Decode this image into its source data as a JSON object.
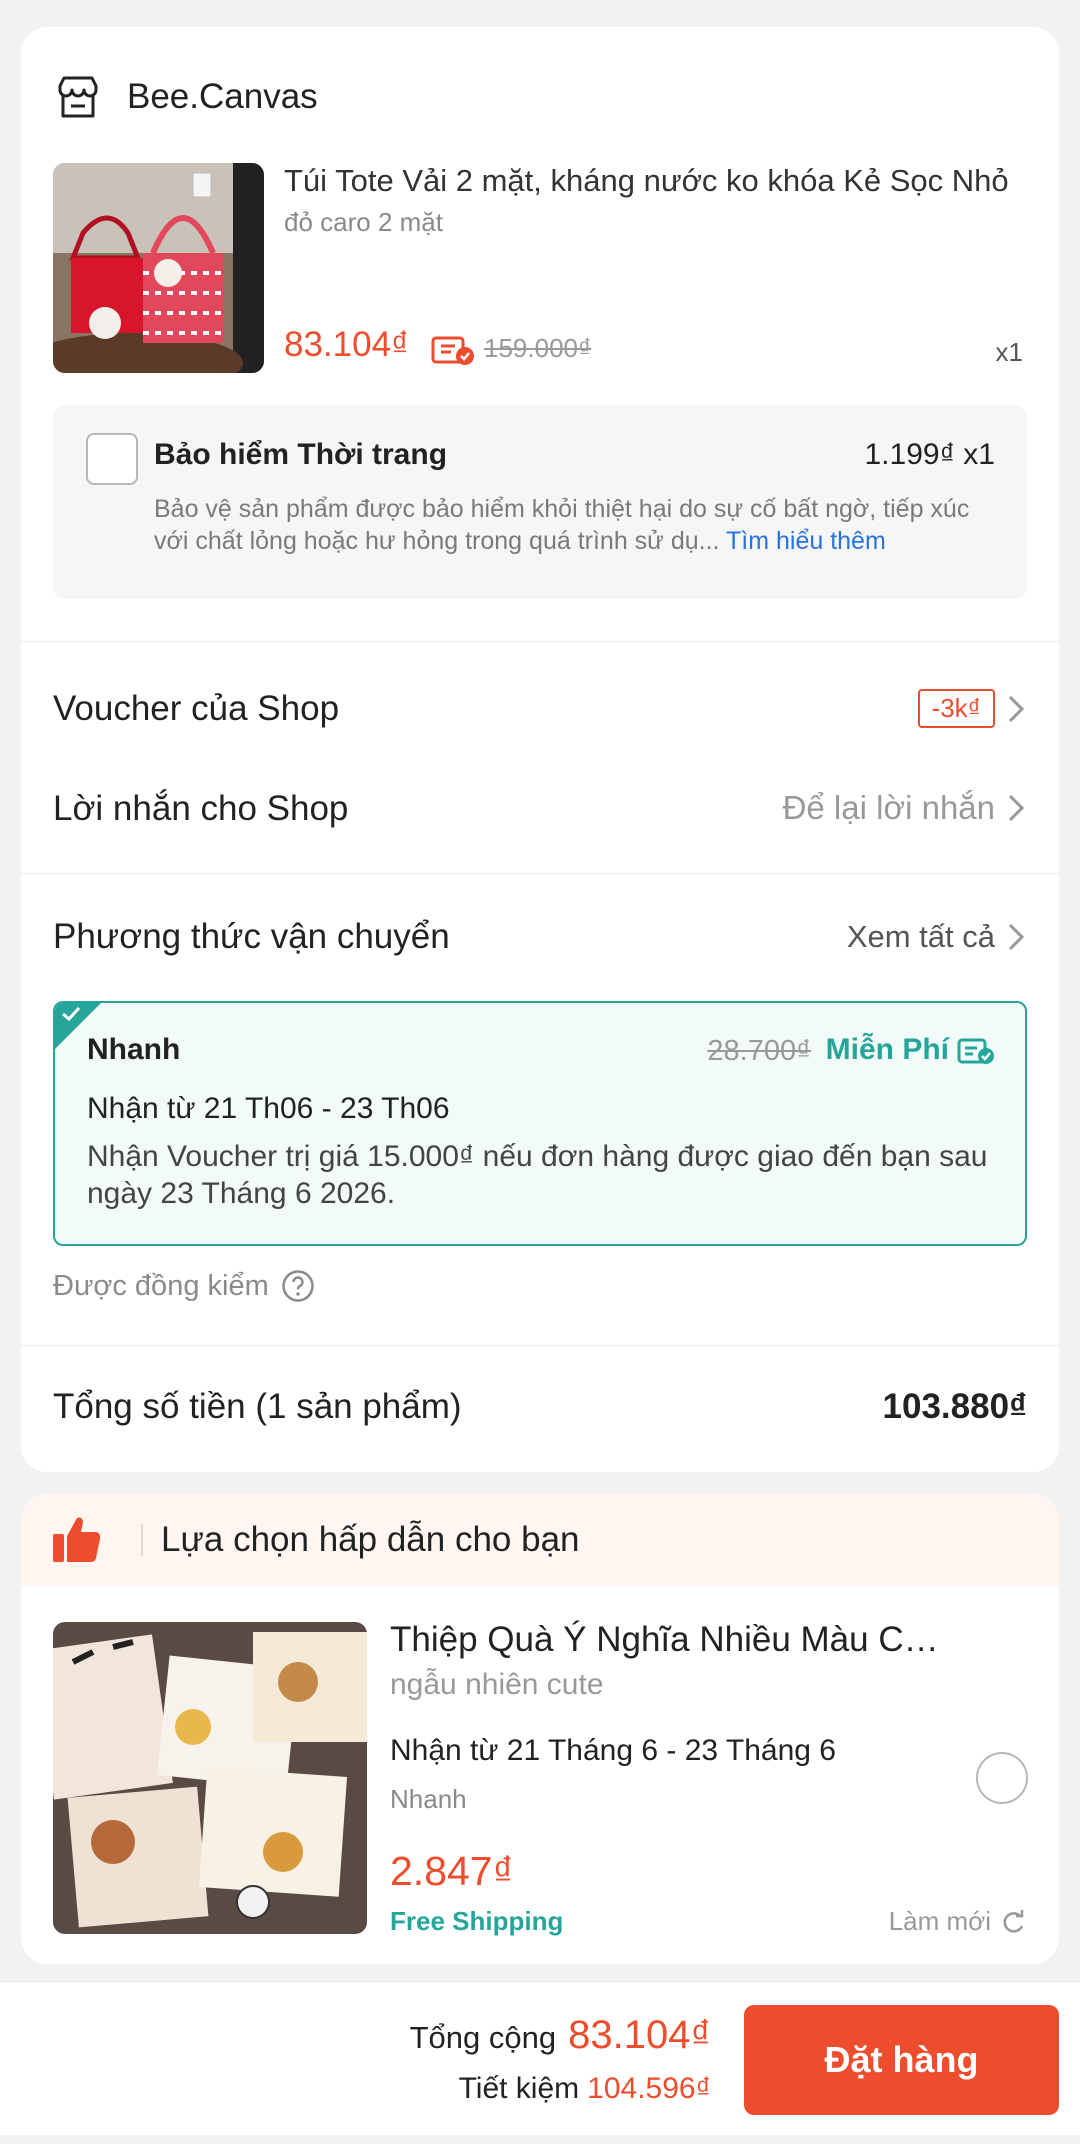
{
  "shop": {
    "name": "Bee.Canvas",
    "icon": "shop-icon"
  },
  "product": {
    "title": "Túi Tote Vải 2 mặt, kháng nước ko khóa Kẻ Sọc Nhỏ",
    "variant": "đỏ caro 2 mặt",
    "price": "83.104₫",
    "original_price": "159.000₫",
    "quantity": "x1"
  },
  "insurance": {
    "title": "Bảo hiểm Thời trang",
    "price": "1.199₫ x1",
    "description": "Bảo vệ sản phẩm được bảo hiểm khỏi thiệt hại do sự cố bất ngờ, tiếp xúc với chất lỏng hoặc hư hỏng trong quá trình sử dụ...",
    "link": "Tìm hiểu thêm"
  },
  "shop_voucher": {
    "label": "Voucher của Shop",
    "tag": "-3k₫"
  },
  "message": {
    "label": "Lời nhắn cho Shop",
    "placeholder": "Để lại lời nhắn"
  },
  "shipping": {
    "label": "Phương thức vận chuyển",
    "see_all": "Xem tất cả",
    "option": {
      "name": "Nhanh",
      "original_fee": "28.700₫",
      "fee": "Miễn Phí",
      "delivery": "Nhận từ 21 Th06 - 23 Th06",
      "note": "Nhận Voucher trị giá 15.000₫ nếu đơn hàng được giao đến bạn sau ngày 23 Tháng 6 2026."
    },
    "inspection": "Được đồng kiểm"
  },
  "order_total": {
    "label": "Tổng số tiền (1 sản phẩm)",
    "value": "103.880₫"
  },
  "recommendation": {
    "title": "Lựa chọn hấp dẫn cho bạn",
    "item": {
      "name": "Thiệp Quà Ý Nghĩa Nhiều Màu Cute",
      "variant": "ngẫu nhiên cute",
      "delivery": "Nhận từ 21 Tháng 6 - 23 Tháng 6",
      "shipping_method": "Nhanh",
      "price": "2.847₫",
      "free_shipping": "Free Shipping",
      "refresh": "Làm mới"
    }
  },
  "footer": {
    "total_label": "Tổng cộng",
    "total_value": "83.104₫",
    "savings_label": "Tiết kiệm",
    "savings_value": "104.596₫",
    "order_button": "Đặt hàng"
  },
  "colors": {
    "accent": "#ee4d2d",
    "teal": "#26a69a",
    "link": "#2673dd"
  }
}
